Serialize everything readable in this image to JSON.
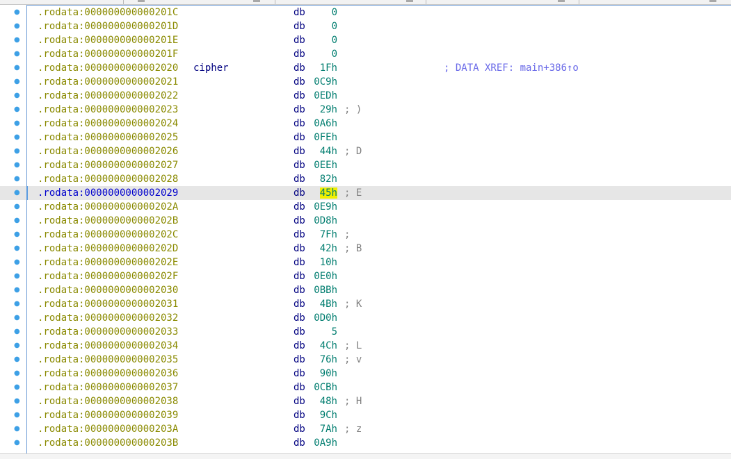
{
  "rows": [
    {
      "addr": ".rodata:000000000000201C",
      "label": "",
      "mnemonic": "db",
      "value": "0",
      "comment": "",
      "xref": ""
    },
    {
      "addr": ".rodata:000000000000201D",
      "label": "",
      "mnemonic": "db",
      "value": "0",
      "comment": "",
      "xref": ""
    },
    {
      "addr": ".rodata:000000000000201E",
      "label": "",
      "mnemonic": "db",
      "value": "0",
      "comment": "",
      "xref": ""
    },
    {
      "addr": ".rodata:000000000000201F",
      "label": "",
      "mnemonic": "db",
      "value": "0",
      "comment": "",
      "xref": ""
    },
    {
      "addr": ".rodata:0000000000002020",
      "label": "cipher",
      "mnemonic": "db",
      "value": "1Fh",
      "comment": "",
      "xref": "; DATA XREF: main+386↑o"
    },
    {
      "addr": ".rodata:0000000000002021",
      "label": "",
      "mnemonic": "db",
      "value": "0C9h",
      "comment": "",
      "xref": ""
    },
    {
      "addr": ".rodata:0000000000002022",
      "label": "",
      "mnemonic": "db",
      "value": "0EDh",
      "comment": "",
      "xref": ""
    },
    {
      "addr": ".rodata:0000000000002023",
      "label": "",
      "mnemonic": "db",
      "value": "29h",
      "comment": "; )",
      "xref": ""
    },
    {
      "addr": ".rodata:0000000000002024",
      "label": "",
      "mnemonic": "db",
      "value": "0A6h",
      "comment": "",
      "xref": ""
    },
    {
      "addr": ".rodata:0000000000002025",
      "label": "",
      "mnemonic": "db",
      "value": "0FEh",
      "comment": "",
      "xref": ""
    },
    {
      "addr": ".rodata:0000000000002026",
      "label": "",
      "mnemonic": "db",
      "value": "44h",
      "comment": "; D",
      "xref": ""
    },
    {
      "addr": ".rodata:0000000000002027",
      "label": "",
      "mnemonic": "db",
      "value": "0EEh",
      "comment": "",
      "xref": ""
    },
    {
      "addr": ".rodata:0000000000002028",
      "label": "",
      "mnemonic": "db",
      "value": "82h",
      "comment": "",
      "xref": ""
    },
    {
      "addr": ".rodata:0000000000002029",
      "label": "",
      "mnemonic": "db",
      "value": "45h",
      "comment": "; E",
      "xref": "",
      "current": true
    },
    {
      "addr": ".rodata:000000000000202A",
      "label": "",
      "mnemonic": "db",
      "value": "0E9h",
      "comment": "",
      "xref": ""
    },
    {
      "addr": ".rodata:000000000000202B",
      "label": "",
      "mnemonic": "db",
      "value": "0D8h",
      "comment": "",
      "xref": ""
    },
    {
      "addr": ".rodata:000000000000202C",
      "label": "",
      "mnemonic": "db",
      "value": "7Fh",
      "comment": ";",
      "xref": ""
    },
    {
      "addr": ".rodata:000000000000202D",
      "label": "",
      "mnemonic": "db",
      "value": "42h",
      "comment": "; B",
      "xref": ""
    },
    {
      "addr": ".rodata:000000000000202E",
      "label": "",
      "mnemonic": "db",
      "value": "10h",
      "comment": "",
      "xref": ""
    },
    {
      "addr": ".rodata:000000000000202F",
      "label": "",
      "mnemonic": "db",
      "value": "0E0h",
      "comment": "",
      "xref": ""
    },
    {
      "addr": ".rodata:0000000000002030",
      "label": "",
      "mnemonic": "db",
      "value": "0BBh",
      "comment": "",
      "xref": ""
    },
    {
      "addr": ".rodata:0000000000002031",
      "label": "",
      "mnemonic": "db",
      "value": "4Bh",
      "comment": "; K",
      "xref": ""
    },
    {
      "addr": ".rodata:0000000000002032",
      "label": "",
      "mnemonic": "db",
      "value": "0D0h",
      "comment": "",
      "xref": ""
    },
    {
      "addr": ".rodata:0000000000002033",
      "label": "",
      "mnemonic": "db",
      "value": "5",
      "comment": "",
      "xref": ""
    },
    {
      "addr": ".rodata:0000000000002034",
      "label": "",
      "mnemonic": "db",
      "value": "4Ch",
      "comment": "; L",
      "xref": ""
    },
    {
      "addr": ".rodata:0000000000002035",
      "label": "",
      "mnemonic": "db",
      "value": "76h",
      "comment": "; v",
      "xref": ""
    },
    {
      "addr": ".rodata:0000000000002036",
      "label": "",
      "mnemonic": "db",
      "value": "90h",
      "comment": "",
      "xref": ""
    },
    {
      "addr": ".rodata:0000000000002037",
      "label": "",
      "mnemonic": "db",
      "value": "0CBh",
      "comment": "",
      "xref": ""
    },
    {
      "addr": ".rodata:0000000000002038",
      "label": "",
      "mnemonic": "db",
      "value": "48h",
      "comment": "; H",
      "xref": ""
    },
    {
      "addr": ".rodata:0000000000002039",
      "label": "",
      "mnemonic": "db",
      "value": "9Ch",
      "comment": "",
      "xref": ""
    },
    {
      "addr": ".rodata:000000000000203A",
      "label": "",
      "mnemonic": "db",
      "value": "7Ah",
      "comment": "; z",
      "xref": ""
    },
    {
      "addr": ".rodata:000000000000203B",
      "label": "",
      "mnemonic": "db",
      "value": "0A9h",
      "comment": "",
      "xref": ""
    }
  ],
  "colors": {
    "address": "#8a8a00",
    "current_address": "#0000cc",
    "mnemonic": "#000080",
    "value": "#007d6f",
    "comment": "#808080",
    "xref": "#6a6ae8",
    "highlight_row": "#e6e6e6",
    "highlight_value": "#f0f000",
    "bullet": "#3da0e6"
  },
  "icons": {
    "gutter_marker": "bullet-dot-icon"
  }
}
